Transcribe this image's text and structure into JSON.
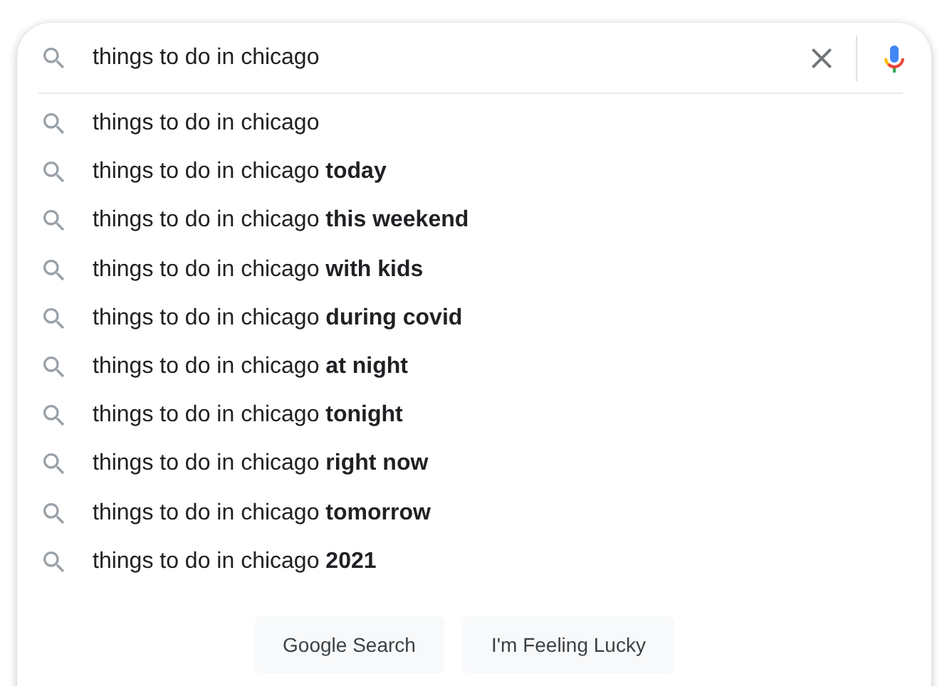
{
  "search": {
    "value": "things to do in chicago"
  },
  "suggestions": [
    {
      "text": "things to do in chicago"
    },
    {
      "text": "things to do in chicago **today**"
    },
    {
      "text": "things to do in chicago **this weekend**"
    },
    {
      "text": "things to do in chicago **with kids**"
    },
    {
      "text": "things to do in chicago **during covid**"
    },
    {
      "text": "things to do in chicago **at night**"
    },
    {
      "text": "things to do in chicago **tonight**"
    },
    {
      "text": "things to do in chicago **right now**"
    },
    {
      "text": "things to do in chicago **tomorrow**"
    },
    {
      "text": "things to do in chicago **2021**"
    }
  ],
  "buttons": [
    "Google Search",
    "I'm Feeling Lucky"
  ]
}
